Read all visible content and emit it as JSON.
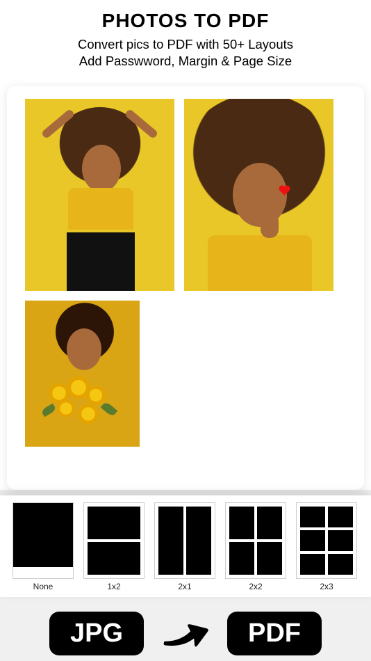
{
  "header": {
    "title": "PHOTOS TO PDF",
    "subtitle": "Convert pics to PDF with 50+ Layouts\nAdd Passwword, Margin & Page Size"
  },
  "photos": [
    {
      "alt": "Person in yellow top, hands behind head, black pants, yellow background"
    },
    {
      "alt": "Close-up of person with large curly hair, hand on chin, small heart on cheek, yellow background"
    },
    {
      "alt": "Person with eyes closed holding yellow flowers near face, mustard background"
    }
  ],
  "layouts": [
    {
      "id": "none",
      "label": "None"
    },
    {
      "id": "1x2",
      "label": "1x2"
    },
    {
      "id": "2x1",
      "label": "2x1"
    },
    {
      "id": "2x2",
      "label": "2x2"
    },
    {
      "id": "2x3",
      "label": "2x3"
    }
  ],
  "footer": {
    "from_label": "JPG",
    "to_label": "PDF",
    "arrow_icon": "arrow-right-icon"
  }
}
